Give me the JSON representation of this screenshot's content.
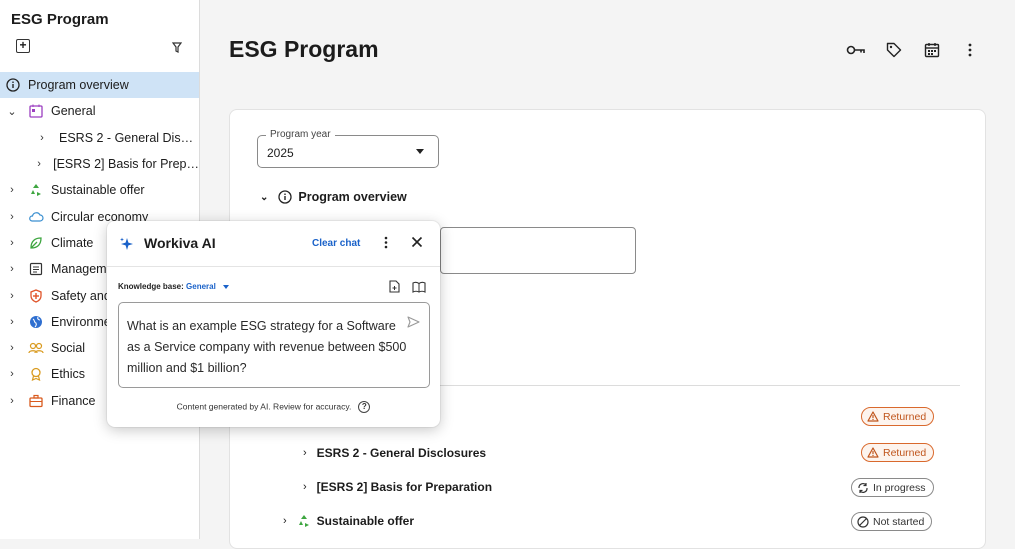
{
  "sidebar": {
    "title": "ESG Program",
    "items": [
      {
        "label": "Program overview",
        "icon": "info-icon"
      },
      {
        "label": "General",
        "icon": "calendar-icon"
      },
      {
        "label": "ESRS 2 - General Dis…"
      },
      {
        "label": "[ESRS 2] Basis for Prep…"
      },
      {
        "label": "Sustainable offer",
        "icon": "recycle-icon"
      },
      {
        "label": "Circular economy",
        "icon": "cloud-icon"
      },
      {
        "label": "Climate",
        "icon": "leaf-icon"
      },
      {
        "label": "Manageme",
        "icon": "list-icon"
      },
      {
        "label": "Safety and",
        "icon": "shield-icon"
      },
      {
        "label": "Environme",
        "icon": "globe-icon"
      },
      {
        "label": "Social",
        "icon": "people-icon"
      },
      {
        "label": "Ethics",
        "icon": "badge-icon"
      },
      {
        "label": "Finance",
        "icon": "briefcase-icon"
      }
    ]
  },
  "main": {
    "title": "ESG Program",
    "program_year_label": "Program year",
    "program_year_value": "2025",
    "section_title": "Program overview",
    "rows": [
      {
        "label": "ESRS 2 - General Disclosures"
      },
      {
        "label": "[ESRS 2] Basis for Preparation"
      },
      {
        "label": "Sustainable offer"
      }
    ],
    "statuses": [
      "Returned",
      "Returned",
      "In progress",
      "Not started"
    ]
  },
  "ai_panel": {
    "title": "Workiva AI",
    "clear_chat": "Clear chat",
    "kb_label": "Knowledge base:",
    "kb_value": "General",
    "prompt": "What is an example ESG strategy for a Software as a Service company with revenue between $500 million and $1 billion?",
    "footer": "Content generated by AI. Review for accuracy."
  },
  "colors": {
    "accent": "#1a62c9",
    "active_bg": "#cfe3f6",
    "returned": "#d9692d"
  }
}
